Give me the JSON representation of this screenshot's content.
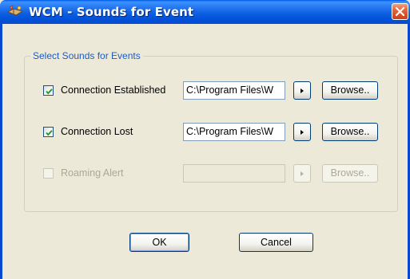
{
  "window": {
    "title": "WCM - Sounds for Event",
    "title_icon": "app-icon",
    "close_icon": "close-icon",
    "title_bar_color": "#0058e6",
    "close_button_color": "#e2643c"
  },
  "group": {
    "label": "Select Sounds for Events",
    "label_color": "#1f5bc6"
  },
  "rows": [
    {
      "checked": true,
      "enabled": true,
      "label": "Connection Established",
      "path": "C:\\Program Files\\W",
      "play_icon": "play-icon",
      "browse_label": "Browse.."
    },
    {
      "checked": true,
      "enabled": true,
      "label": "Connection Lost",
      "path": "C:\\Program Files\\W",
      "play_icon": "play-icon",
      "browse_label": "Browse.."
    },
    {
      "checked": false,
      "enabled": false,
      "label": "Roaming Alert",
      "path": "",
      "play_icon": "play-icon",
      "browse_label": "Browse.."
    }
  ],
  "buttons": {
    "ok_label": "OK",
    "cancel_label": "Cancel"
  },
  "colors": {
    "dialog_background": "#ece9d8",
    "disabled_text": "#aca899",
    "checkmark": "#21a121"
  }
}
